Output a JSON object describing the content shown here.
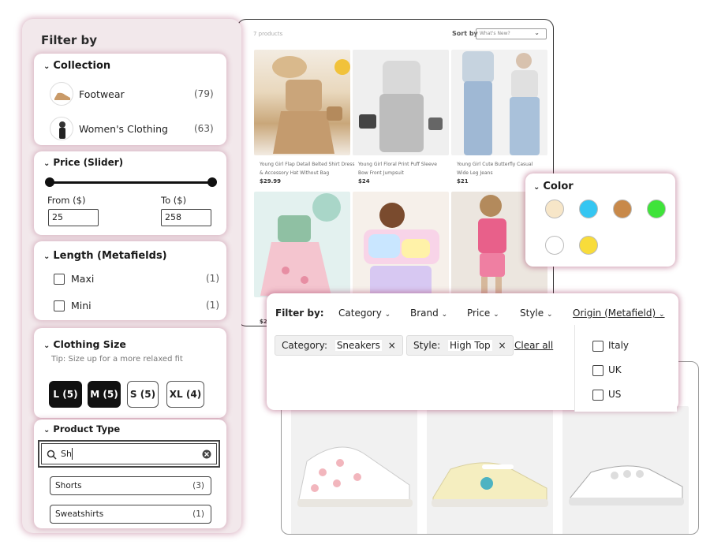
{
  "store": {
    "product_count": "7 products",
    "sort_label": "Sort by",
    "sort_value": "What's New?",
    "products": [
      {
        "title": "Young Girl Flap Detail Belted Shirt Dress & Accessory Hat Without Bag",
        "price": "$29.99"
      },
      {
        "title": "Young Girl Floral Print Puff Sleeve Bow Front Jumpsuit",
        "price": "$24"
      },
      {
        "title": "Young Girl Cute Butterfly Casual Wide Leg Jeans",
        "price": "$21"
      }
    ],
    "partial_price": "$2"
  },
  "sidebar": {
    "title": "Filter by",
    "collection": {
      "heading": "Collection",
      "items": [
        {
          "label": "Footwear",
          "count": "(79)"
        },
        {
          "label": "Women's Clothing",
          "count": "(63)"
        }
      ]
    },
    "price": {
      "heading": "Price (Slider)",
      "from_label": "From ($)",
      "to_label": "To ($)",
      "from_value": "25",
      "to_value": "258"
    },
    "length": {
      "heading": "Length (Metafields)",
      "items": [
        {
          "label": "Maxi",
          "count": "(1)"
        },
        {
          "label": "Mini",
          "count": "(1)"
        }
      ]
    },
    "size": {
      "heading": "Clothing Size",
      "tip": "Tip: Size up for a more relaxed fit",
      "buttons": [
        "L (5)",
        "M (5)",
        "S (5)",
        "XL (4)"
      ]
    },
    "product_type": {
      "heading": "Product Type",
      "search_value": "Sh",
      "items": [
        {
          "label": "Shorts",
          "count": "(3)"
        },
        {
          "label": "Sweatshirts",
          "count": "(1)"
        }
      ]
    }
  },
  "color_filter": {
    "heading": "Color",
    "swatches": [
      "#f7e6c8",
      "#35c6f2",
      "#c8894a",
      "#3fe33a",
      "#ffffff",
      "#f8dc3a"
    ]
  },
  "filter_bar": {
    "label": "Filter by:",
    "items": [
      "Category",
      "Brand",
      "Price",
      "Style",
      "Origin (Metafield)"
    ],
    "chips": [
      {
        "key": "Category:",
        "value": "Sneakers"
      },
      {
        "key": "Style:",
        "value": "High Top"
      }
    ],
    "clear_all": "Clear all",
    "origin_options": [
      "Italy",
      "UK",
      "US"
    ]
  },
  "colors": {
    "accent_glow": "#a03c64",
    "active_size": "#111111"
  }
}
